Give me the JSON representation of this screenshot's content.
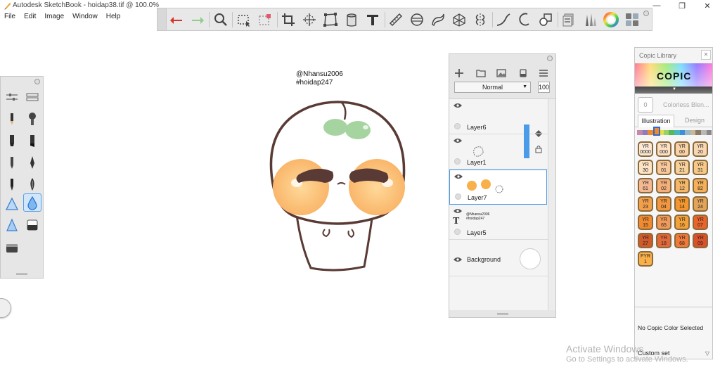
{
  "window": {
    "title": "Autodesk SketchBook - hoidap38.tif @ 100.0%",
    "controls": [
      "—",
      "❐",
      "✕"
    ]
  },
  "menu": [
    "File",
    "Edit",
    "Image",
    "Window",
    "Help"
  ],
  "toolbar": {
    "tools": [
      "undo-icon",
      "redo-icon",
      "zoom-icon",
      "select-icon",
      "lasso-icon",
      "crop-icon",
      "transform-icon",
      "distort-icon",
      "fill-icon",
      "text-icon",
      "ruler-icon",
      "ellipse-guide-icon",
      "french-curve-icon",
      "perspective-icon",
      "symmetry-icon",
      "steady-stroke-icon",
      "predictive-icon",
      "shape-icon",
      "copic-icon",
      "brush-library-icon",
      "color-wheel-icon",
      "layout-icon"
    ]
  },
  "canvas": {
    "signature_line1": "@Nhansu2006",
    "signature_line2": "#hoidap247"
  },
  "layers": {
    "blend_mode": "Normal",
    "opacity": "100",
    "items": [
      {
        "name": "Layer6",
        "selected": false
      },
      {
        "name": "Layer1",
        "selected": false
      },
      {
        "name": "Layer7",
        "selected": true
      },
      {
        "name": "Layer5",
        "selected": false
      }
    ],
    "background": "Background",
    "text_thumb_line1": "@Nhansu2006",
    "text_thumb_line2": "#hoidap247"
  },
  "copic": {
    "title": "Copic Library",
    "logo": "COPIC",
    "colorless_swatch": "0",
    "colorless_label": "Colorless Blen...",
    "tabs": [
      "Illustration",
      "Design"
    ],
    "family_colors": [
      "#c48aa8",
      "#8c7cc4",
      "#f08a2a",
      "#f5c02a",
      "#e8e04a",
      "#9ad26a",
      "#5ab85a",
      "#4ab6c0",
      "#3f8fd8",
      "#9ab8c8",
      "#c8b89a",
      "#8a7a6a",
      "#b8b8b8",
      "#888888"
    ],
    "swatches": [
      {
        "code": "YR 0000",
        "color": "#fbe9d6"
      },
      {
        "code": "YR 000",
        "color": "#fbe0c4"
      },
      {
        "code": "YR 00",
        "color": "#f9d2a8"
      },
      {
        "code": "YR 20",
        "color": "#f8d8b4"
      },
      {
        "code": "YR 30",
        "color": "#fbe3c4"
      },
      {
        "code": "YR 01",
        "color": "#f8c79a"
      },
      {
        "code": "YR 21",
        "color": "#f6d09a"
      },
      {
        "code": "YR 31",
        "color": "#f6c98a"
      },
      {
        "code": "YR 61",
        "color": "#f4b892"
      },
      {
        "code": "YR 02",
        "color": "#f5b07a"
      },
      {
        "code": "YR 12",
        "color": "#f5b86a"
      },
      {
        "code": "YR 82",
        "color": "#f4b05a"
      },
      {
        "code": "YR 23",
        "color": "#f3a04a"
      },
      {
        "code": "YR 04",
        "color": "#f29640"
      },
      {
        "code": "YR 14",
        "color": "#f3962e"
      },
      {
        "code": "YR 24",
        "color": "#e3a45a"
      },
      {
        "code": "YR 15",
        "color": "#f08a30"
      },
      {
        "code": "YR 65",
        "color": "#ef9a5a"
      },
      {
        "code": "YR 16",
        "color": "#f3a23a"
      },
      {
        "code": "YR 07",
        "color": "#e8642a"
      },
      {
        "code": "YR 27",
        "color": "#cf5a2a"
      },
      {
        "code": "YR 18",
        "color": "#e0683a"
      },
      {
        "code": "YR 68",
        "color": "#ef7a3a"
      },
      {
        "code": "YR 09",
        "color": "#d9502a"
      },
      {
        "code": "FYR 1",
        "color": "#f7b04a"
      }
    ],
    "status": "No Copic Color Selected",
    "set_name": "Custom set"
  },
  "watermark": {
    "title": "Activate Windows",
    "subtitle": "Go to Settings to activate Windows."
  }
}
